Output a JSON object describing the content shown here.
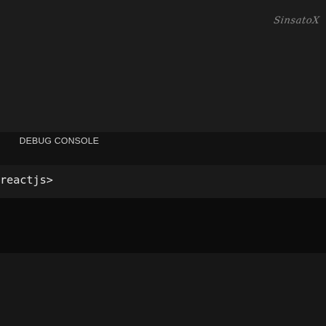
{
  "watermark": "SinsatoX",
  "panel": {
    "tabs": [
      {
        "label": "DEBUG CONSOLE"
      }
    ]
  },
  "console": {
    "prompt": "reactjs>"
  }
}
